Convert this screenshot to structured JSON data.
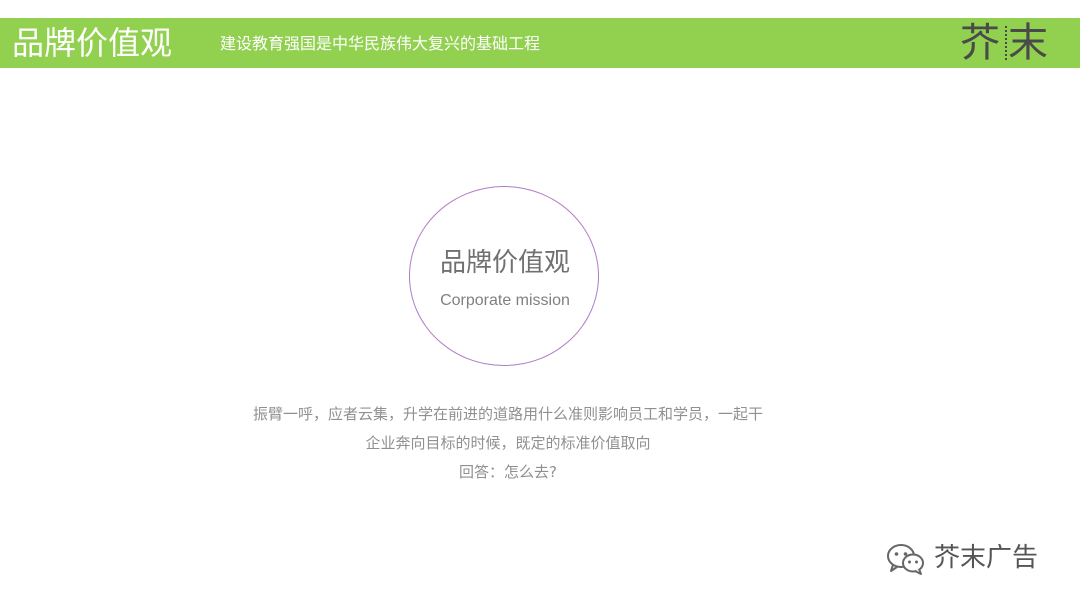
{
  "header": {
    "title": "品牌价值观",
    "subtitle": "建设教育强国是中华民族伟大复兴的基础工程",
    "logo_text": "芥末",
    "band_color": "#92d050"
  },
  "center": {
    "title": "品牌价值观",
    "subtitle": "Corporate mission",
    "circle_color": "#b07cc6"
  },
  "body": {
    "lines": [
      "振臂一呼，应者云集，升学在前进的道路用什么准则影响员工和学员，一起干",
      "企业奔向目标的时候，既定的标准价值取向",
      "回答：怎么去?"
    ]
  },
  "watermark": {
    "icon": "wechat-icon",
    "text": "芥末广告"
  }
}
